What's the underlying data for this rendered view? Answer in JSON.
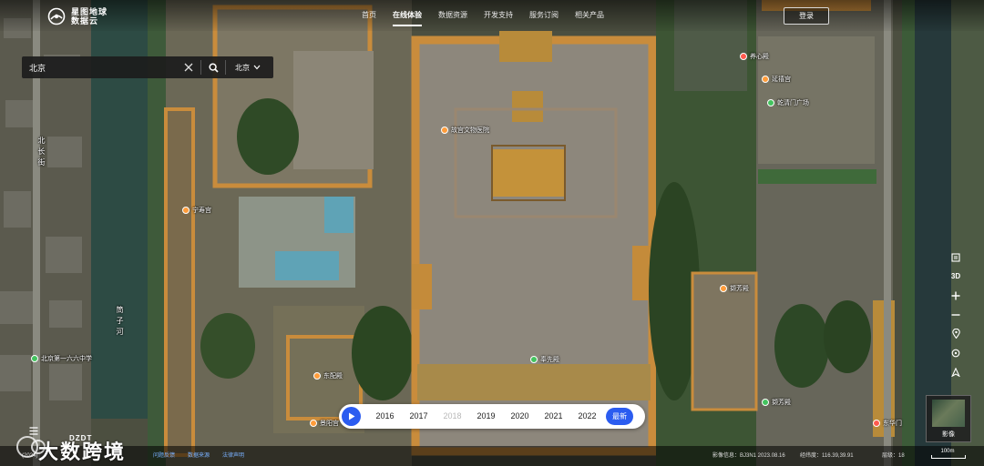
{
  "brand": {
    "line1": "星图地球",
    "line2": "数据云"
  },
  "nav": {
    "items": [
      {
        "label": "首页",
        "active": false
      },
      {
        "label": "在线体验",
        "active": true
      },
      {
        "label": "数据资源",
        "active": false
      },
      {
        "label": "开发支持",
        "active": false
      },
      {
        "label": "服务订阅",
        "active": false
      },
      {
        "label": "相关产品",
        "active": false
      }
    ],
    "login_label": "登录"
  },
  "search": {
    "value": "北京",
    "placeholder": "",
    "city": "北京"
  },
  "map": {
    "pois": [
      {
        "label": "养心殿",
        "color": "red",
        "icon": "poi-dot"
      },
      {
        "label": "延禧宫",
        "color": "orange",
        "icon": "poi-dot"
      },
      {
        "label": "乾清门广场",
        "color": "green",
        "icon": "poi-dot"
      },
      {
        "label": "故宫文物医院",
        "color": "orange",
        "icon": "poi-dot"
      },
      {
        "label": "宁寿宫",
        "color": "orange",
        "icon": "poi-dot"
      },
      {
        "label": "奉先殿",
        "color": "green",
        "icon": "poi-dot"
      },
      {
        "label": "北京第一六六中学",
        "color": "green",
        "icon": "poi-dot"
      },
      {
        "label": "东配殿",
        "color": "orange",
        "icon": "poi-dot"
      },
      {
        "label": "景阳宫",
        "color": "orange",
        "icon": "poi-dot"
      },
      {
        "label": "撷芳殿",
        "color": "orange",
        "icon": "poi-dot"
      },
      {
        "label": "东华门",
        "color": "red",
        "icon": "poi-dot"
      }
    ],
    "roads": [
      {
        "label": "筒子河"
      },
      {
        "label": "北长街"
      }
    ]
  },
  "timeline": {
    "years": [
      {
        "label": "2016",
        "disabled": false
      },
      {
        "label": "2017",
        "disabled": false
      },
      {
        "label": "2018",
        "disabled": true
      },
      {
        "label": "2019",
        "disabled": false
      },
      {
        "label": "2020",
        "disabled": false
      },
      {
        "label": "2021",
        "disabled": false
      },
      {
        "label": "2022",
        "disabled": false
      }
    ],
    "latest_label": "最新"
  },
  "controls": {
    "mode_3d": "3D",
    "layer_label": "影像",
    "scale": "100m"
  },
  "statusbar": {
    "copyright": "(2024)",
    "link1": "问题反馈",
    "link2": "数据来源",
    "link3": "法律声明",
    "image_info": "影像信息：BJ3N1 2023.08.16",
    "coords": "经纬度：116.39,39.91",
    "level": "层级：18",
    "mini_brand": "DZDT"
  },
  "watermark": {
    "text": "大数跨境"
  },
  "icons": {
    "search": "search-icon",
    "clear": "close-icon",
    "dropdown": "chevron-down-icon",
    "play": "play-icon",
    "legend": "legend-icon",
    "zoom_in": "plus-icon",
    "zoom_out": "minus-icon",
    "location": "location-pin-icon",
    "locate": "target-icon",
    "compass": "compass-icon",
    "menu": "menu-icon"
  },
  "colors": {
    "accent": "#2b5cf0",
    "poi_orange": "#ff9c3a",
    "poi_green": "#43c35e",
    "poi_red": "#ff5a4e"
  }
}
